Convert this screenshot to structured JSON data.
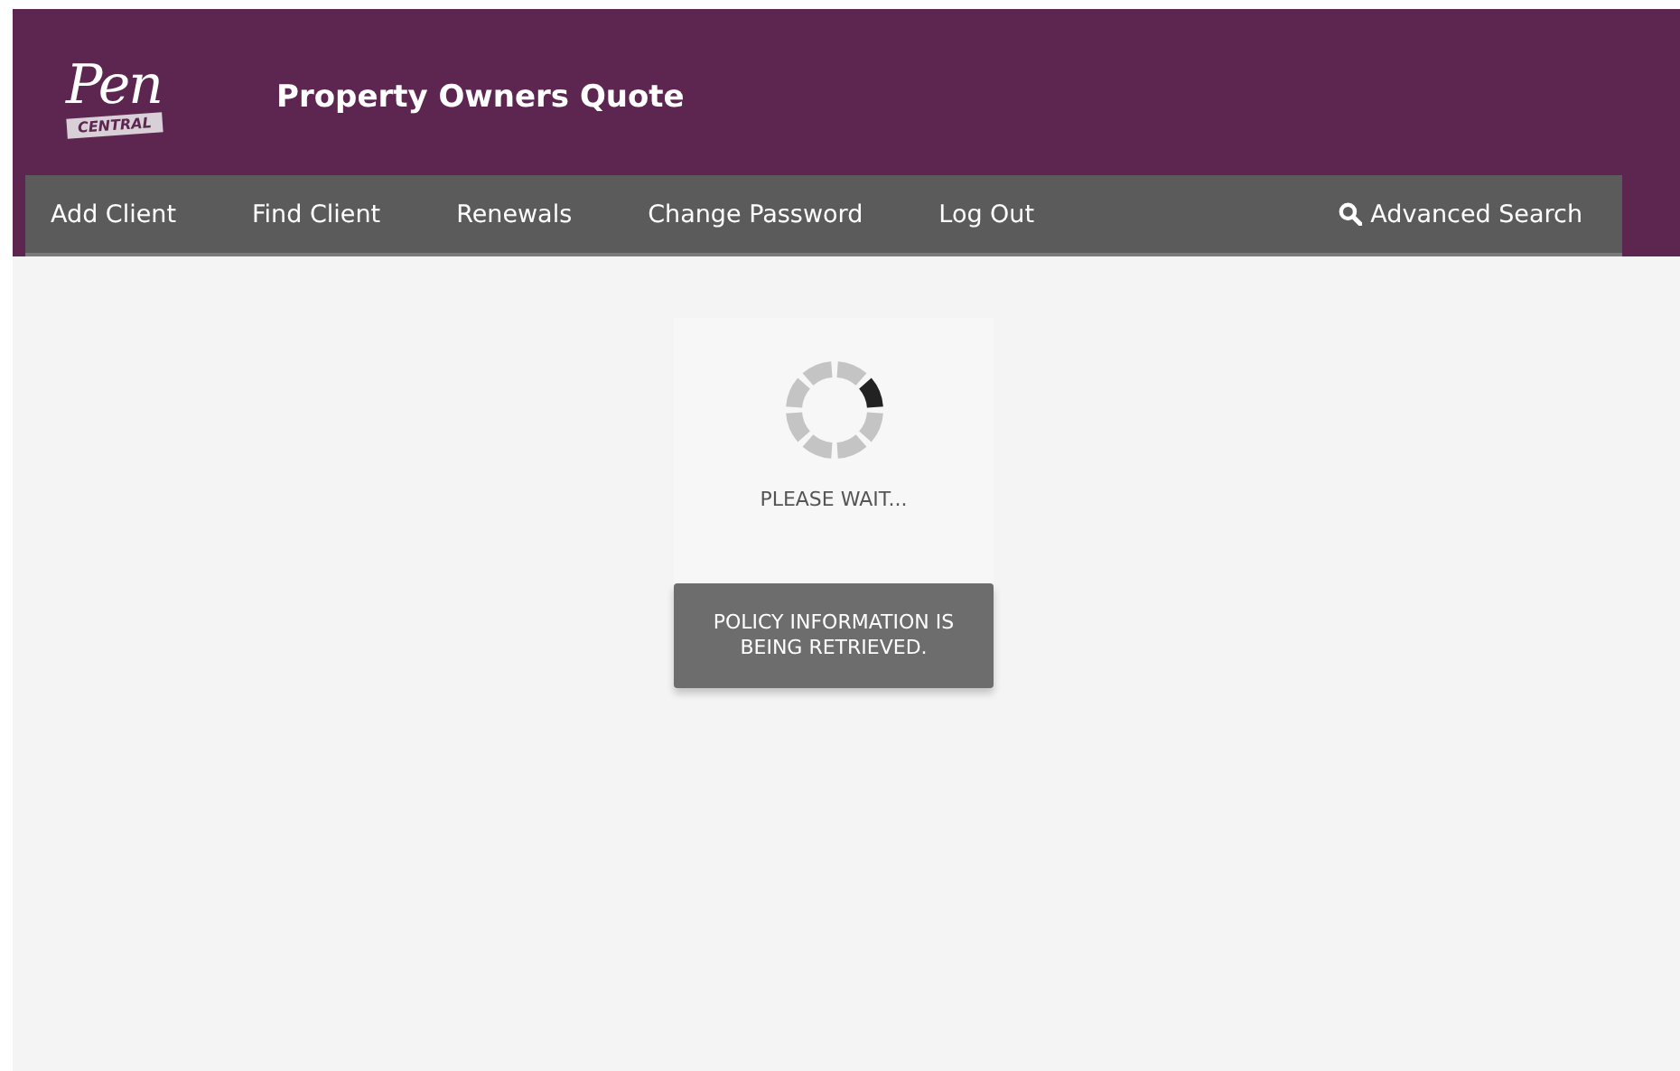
{
  "logo": {
    "script": "Pen",
    "banner": "CENTRAL"
  },
  "header": {
    "title": "Property Owners Quote"
  },
  "nav": {
    "items": [
      {
        "label": "Add Client"
      },
      {
        "label": "Find Client"
      },
      {
        "label": "Renewals"
      },
      {
        "label": "Change Password"
      },
      {
        "label": "Log Out"
      }
    ],
    "search_link": {
      "label": "Advanced Search"
    }
  },
  "loader": {
    "status": "PLEASE WAIT...",
    "message": "POLICY INFORMATION IS BEING RETRIEVED."
  }
}
